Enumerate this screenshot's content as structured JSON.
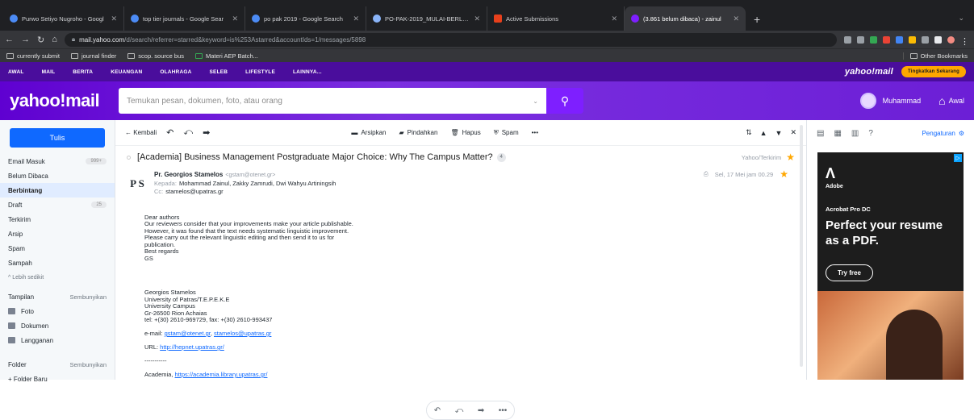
{
  "browser": {
    "tabs": [
      {
        "title": "Purwo Setiyo Nugroho - Googl",
        "color": "#4c8bf5"
      },
      {
        "title": "top tier journals - Google Sear",
        "color": "#4c8bf5"
      },
      {
        "title": "po pak 2019 - Google Search",
        "color": "#4c8bf5"
      },
      {
        "title": "PO-PAK-2019_MULAI-BERLAK",
        "color": "#8ab4f8"
      },
      {
        "title": "Active Submissions",
        "color": "#e8401c"
      },
      {
        "title": "(3.861 belum dibaca) - zainul",
        "color": "#7e1fff"
      }
    ],
    "new_tab": "+",
    "url_host": "mail.yahoo.com",
    "url_path": "/d/search/referrer=starred&keyword=is%253Astarred&accountIds=1/messages/5898",
    "bookmarks": [
      "currently submit",
      "journal finder",
      "scop. source bus",
      "Materi AEP Batch..."
    ],
    "other_bookmarks": "Other Bookmarks"
  },
  "yahoo_nav": {
    "items": [
      "AWAL",
      "MAIL",
      "BERITA",
      "KEUANGAN",
      "OLAHRAGA",
      "SELEB",
      "LIFESTYLE",
      "LAINNYA..."
    ],
    "brand": "yahoo!mail",
    "upgrade": "Tingkatkan Sekarang"
  },
  "header": {
    "logo": "yahoo!mail",
    "search_placeholder": "Temukan pesan, dokumen, foto, atau orang",
    "user_name": "Muhammad",
    "home_label": "Awal"
  },
  "sidebar": {
    "compose": "Tulis",
    "folders": [
      {
        "label": "Email Masuk",
        "count": "999+"
      },
      {
        "label": "Belum Dibaca",
        "count": ""
      },
      {
        "label": "Berbintang",
        "count": ""
      },
      {
        "label": "Draft",
        "count": "25"
      },
      {
        "label": "Terkirim",
        "count": ""
      },
      {
        "label": "Arsip",
        "count": ""
      },
      {
        "label": "Spam",
        "count": ""
      },
      {
        "label": "Sampah",
        "count": ""
      }
    ],
    "less": "^ Lebih sedikit",
    "views_title": "Tampilan",
    "views_toggle": "Sembunyikan",
    "views": [
      "Foto",
      "Dokumen",
      "Langganan"
    ],
    "folder_title": "Folder",
    "folder_toggle": "Sembunyikan",
    "new_folder": "+ Folder Baru"
  },
  "toolbar": {
    "back": "Kembali",
    "archive": "Arsipkan",
    "move": "Pindahkan",
    "delete": "Hapus",
    "spam": "Spam",
    "more": "•••"
  },
  "message": {
    "subject": "[Academia] Business Management Postgraduate Major Choice: Why The Campus Matter?",
    "thread_count": "4",
    "folder": "Yahoo/Terkirim",
    "initials": "P S",
    "from_name": "Pr. Georgios Stamelos",
    "from_email": "<gstam@otenet.gr>",
    "to_label": "Kepada:",
    "to": "Mohammad Zainul,  Zakky Zamrudi,  Dwi Wahyu Artiningsih",
    "cc_label": "Cc:",
    "cc": "stamelos@upatras.gr",
    "date": "Sel, 17 Mei jam 00.29",
    "body_1": "Dear authors\nOur reviewers consider that your improvements make your article publishable.\nHowever, it was found that the text needs systematic linguistic improvement.\nPlease carry out the relevant linguistic editing and then send it to us for\npublication.\nBest regards\nGS",
    "body_2": "Georgios Stamelos\nUniversity of Patras/T.E.P.E.K.E\nUniversity Campus\nGr-26500 Rion Achaias\ntel: +(30) 2610-969729, fax: +(30) 2610-993437",
    "email_label": "e-mail: ",
    "email_1": "gstam@otenet.gr",
    "email_2": "stamelos@upatras.gr",
    "url_label": "URL: ",
    "url": "http://hepnet.upatras.gr/",
    "sep": "-----------",
    "academia_label": "Academia, ",
    "academia_url": "https://academia.library.upatras.gr/"
  },
  "right_panel": {
    "settings": "Pengaturan"
  },
  "ad": {
    "brand": "Adobe",
    "product": "Acrobat Pro DC",
    "headline": "Perfect your resume as a PDF.",
    "cta": "Try free"
  }
}
